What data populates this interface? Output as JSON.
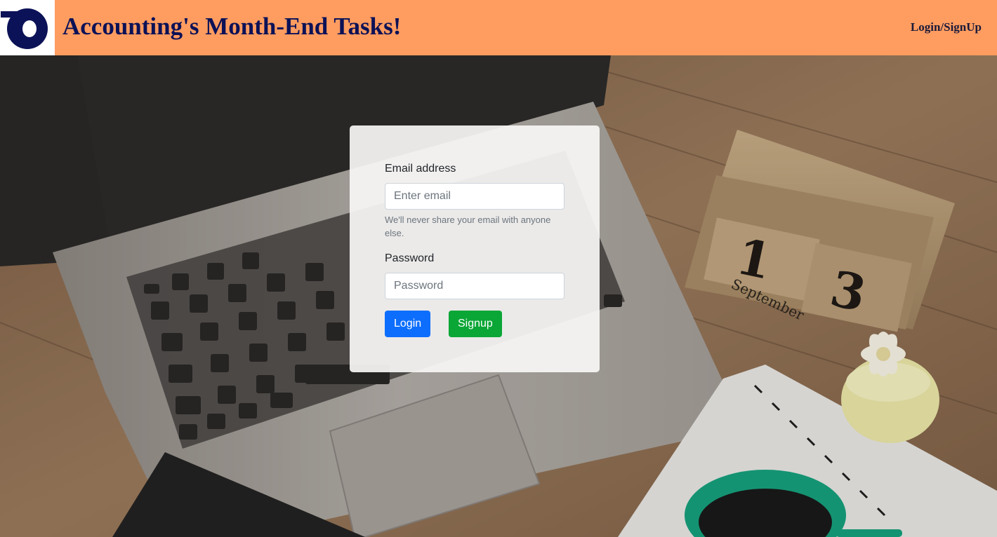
{
  "header": {
    "title": "Accounting's Month-End Tasks!",
    "nav_link": "Login/SignUp",
    "logo_icon": "brand-logo-icon",
    "background_color": "#ff9c60",
    "title_color": "#0b1257"
  },
  "background": {
    "calendar_day_digit_1": "1",
    "calendar_day_digit_2": "3",
    "calendar_month": "September"
  },
  "login_form": {
    "email_label": "Email address",
    "email_placeholder": "Enter email",
    "email_value": "",
    "email_help": "We'll never share your email with anyone else.",
    "password_label": "Password",
    "password_placeholder": "Password",
    "password_value": "",
    "login_button": "Login",
    "signup_button": "Signup",
    "login_button_color": "#0d6efd",
    "signup_button_color": "#0aa636"
  }
}
